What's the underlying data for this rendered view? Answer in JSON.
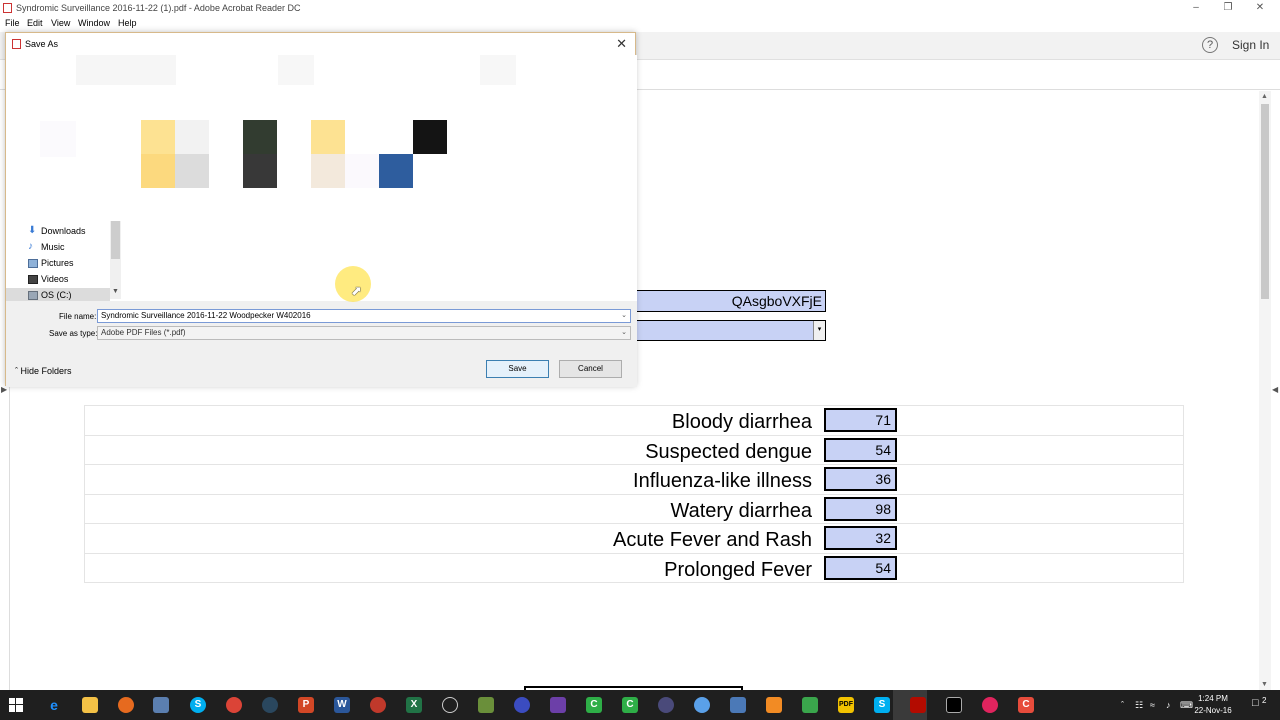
{
  "window": {
    "title": "Syndromic Surveillance 2016-11-22 (1).pdf - Adobe Acrobat Reader DC",
    "min_glyph": "–",
    "max_glyph": "❐",
    "close_glyph": "✕"
  },
  "menu": [
    "File",
    "Edit",
    "View",
    "Window",
    "Help"
  ],
  "toolbar": {
    "help_glyph": "?",
    "signin": "Sign In"
  },
  "form": {
    "code_value": "QAsgboVXFjE",
    "dropdown_arrow": "▾"
  },
  "table": {
    "rows": [
      {
        "label": "Bloody diarrhea",
        "value": "71"
      },
      {
        "label": "Suspected dengue",
        "value": "54"
      },
      {
        "label": "Influenza-like illness",
        "value": "36"
      },
      {
        "label": "Watery diarrhea",
        "value": "98"
      },
      {
        "label": "Acute Fever and Rash",
        "value": "32"
      },
      {
        "label": "Prolonged Fever",
        "value": "54"
      }
    ]
  },
  "dialog": {
    "title": "Save As",
    "close_glyph": "✕",
    "nav_items": [
      "Downloads",
      "Music",
      "Pictures",
      "Videos",
      "OS (C:)"
    ],
    "file_name_label": "File name:",
    "file_name_value": "Syndromic Surveillance 2016-11-22 Woodpecker W402016",
    "save_type_label": "Save as type:",
    "save_type_value": "Adobe PDF Files (*.pdf)",
    "hide_folders": "Hide Folders",
    "save_button": "Save",
    "cancel_button": "Cancel",
    "arrow_glyph": "⌵"
  },
  "taskbar": {
    "time": "1:24 PM",
    "date": "22-Nov-16",
    "notification_count": "2"
  },
  "colors": {
    "field_fill": "#c8d2f5",
    "taskbar_bg": "#1f1f1f",
    "dialog_border": "#d7b98a",
    "cursor_highlight": "#ffe13c"
  }
}
